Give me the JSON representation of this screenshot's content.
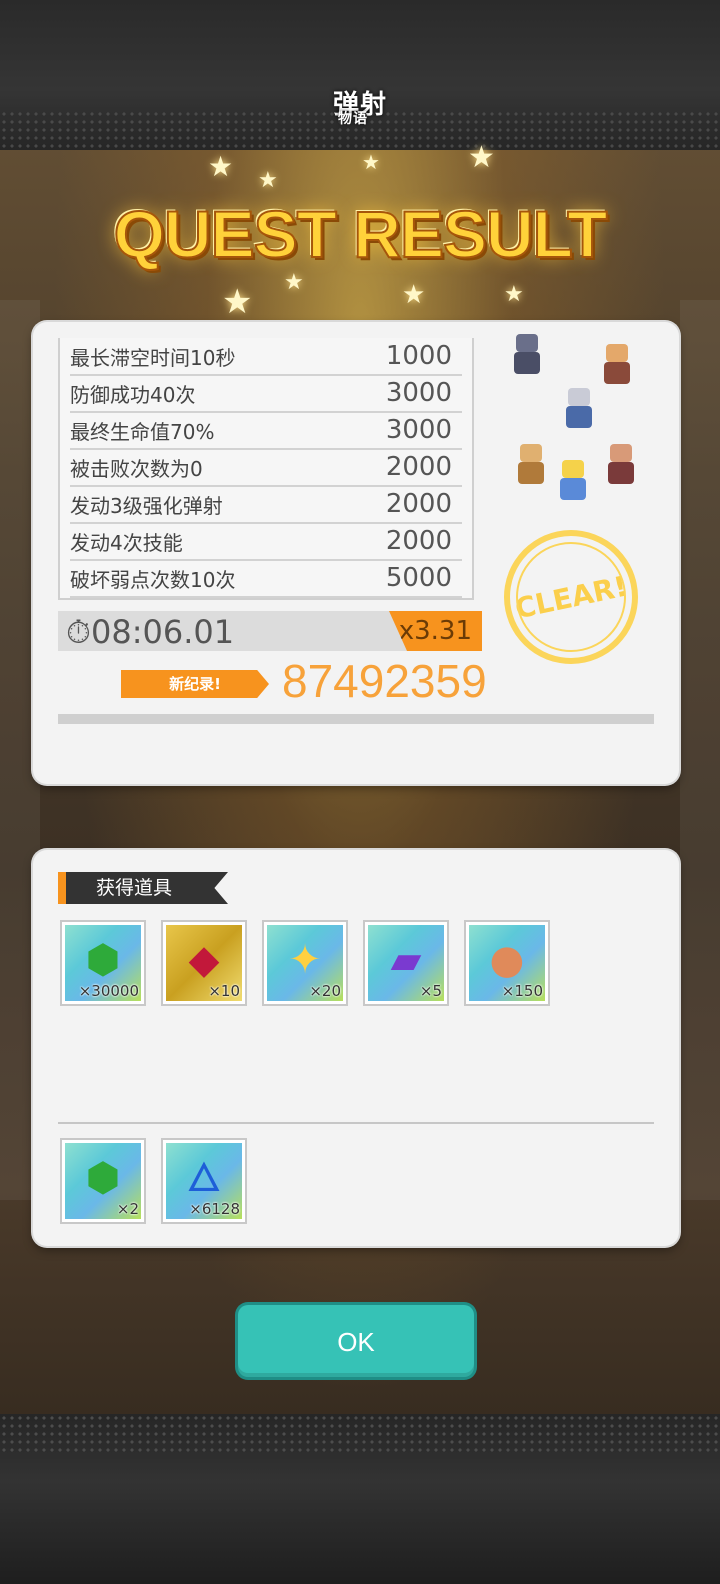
{
  "app": {
    "logo_text": "弹射",
    "logo_sub": "物语"
  },
  "title": "QUEST RESULT",
  "score_rows": [
    {
      "label": "最长滞空时间10秒",
      "points": "1000"
    },
    {
      "label": "防御成功40次",
      "points": "3000"
    },
    {
      "label": "最终生命值70%",
      "points": "3000"
    },
    {
      "label": "被击败次数为0",
      "points": "2000"
    },
    {
      "label": "发动3级强化弹射",
      "points": "2000"
    },
    {
      "label": "发动4次技能",
      "points": "2000"
    },
    {
      "label": "破坏弱点次数10次",
      "points": "5000"
    }
  ],
  "clear_time": "08:06.01",
  "multiplier": "x3.31",
  "new_record_label": "新纪录!",
  "total_score": "87492359",
  "clear_stamp": "CLEAR!",
  "items_section_title": "获得道具",
  "rewards": [
    {
      "icon": "green-gem-icon",
      "count": "×30000"
    },
    {
      "icon": "red-crystal-icon",
      "count": "×10"
    },
    {
      "icon": "gold-star-icon",
      "count": "×20"
    },
    {
      "icon": "purple-ticket-icon",
      "count": "×5"
    },
    {
      "icon": "rainbow-orb-icon",
      "count": "×150"
    }
  ],
  "bonus_rewards": [
    {
      "icon": "green-gem-icon",
      "count": "×2"
    },
    {
      "icon": "blue-flame-icon",
      "count": "×6128"
    }
  ],
  "ok_label": "OK",
  "colors": {
    "accent": "#f7931e",
    "ok_button": "#36c2b6",
    "title_gold": "#ffd23a",
    "stamp": "#fbd55a"
  }
}
